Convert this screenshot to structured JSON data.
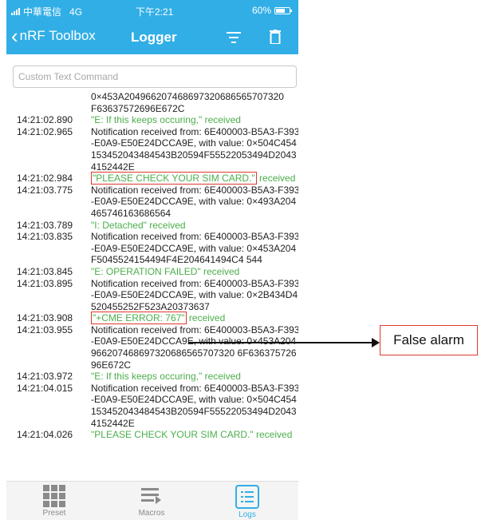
{
  "status_bar": {
    "carrier": "中華電信",
    "network": "4G",
    "time": "下午2:21",
    "battery": "60%"
  },
  "nav": {
    "back_label": "nRF Toolbox",
    "title": "Logger"
  },
  "command": {
    "placeholder": "Custom Text Command",
    "value": ""
  },
  "log_entries": [
    {
      "time": "",
      "text": "0×453A204966207468697320686565707320",
      "green": false
    },
    {
      "time": "",
      "text": "F63637572696E672C",
      "green": false
    },
    {
      "time": "14:21:02.890",
      "text": "\"E: If this keeps occuring,\" received",
      "green": true
    },
    {
      "time": "14:21:02.965",
      "text": "Notification received from: 6E400003-B5A3-F393-E0A9-E50E24DCCA9E, with value: 0×504C454153452043484543B20594F55522053494D20434152442E",
      "green": false
    },
    {
      "time": "14:21:02.984",
      "highlight": "\"PLEASE CHECK YOUR SIM CARD.\"",
      "text": " received",
      "green": true
    },
    {
      "time": "14:21:03.775",
      "text": "Notification received from: 6E400003-B5A3-F393-E0A9-E50E24DCCA9E, with value: 0×493A204465746163686564",
      "green": false
    },
    {
      "time": "14:21:03.789",
      "text": "\"I: Detached\" received",
      "green": true
    },
    {
      "time": "14:21:03.835",
      "text": "Notification received from: 6E400003-B5A3-F393-E0A9-E50E24DCCA9E, with value: 0×453A204F5045524154494F4E204641494C4 544",
      "green": false
    },
    {
      "time": "14:21:03.845",
      "text": "\"E: OPERATION FAILED\" received",
      "green": true
    },
    {
      "time": "14:21:03.895",
      "text": "Notification received from: 6E400003-B5A3-F393-E0A9-E50E24DCCA9E, with value: 0×2B434D4520455252F523A20373637",
      "green": false
    },
    {
      "time": "14:21:03.908",
      "highlight": "\"+CME ERROR: 767\"",
      "text": " received",
      "green": true
    },
    {
      "time": "14:21:03.955",
      "text": "Notification received from: 6E400003-B5A3-F393-E0A9-E50E24DCCA9E, with value: 0×453A204966207468697320686565707320 6F63637572696E672C",
      "green": false
    },
    {
      "time": "14:21:03.972",
      "text": "\"E: If this keeps occuring,\" received",
      "green": true
    },
    {
      "time": "14:21:04.015",
      "text": "Notification received from: 6E400003-B5A3-F393-E0A9-E50E24DCCA9E, with value: 0×504C454153452043484543B20594F55522053494D20434152442E",
      "green": false
    },
    {
      "time": "14:21:04.026",
      "text": "\"PLEASE CHECK YOUR SIM CARD.\" received",
      "green": true
    }
  ],
  "tabs": [
    {
      "label": "Preset",
      "icon": "grid-icon"
    },
    {
      "label": "Macros",
      "icon": "macros-icon"
    },
    {
      "label": "Logs",
      "icon": "logs-icon",
      "active": true
    }
  ],
  "annotation": {
    "label": "False alarm"
  },
  "colors": {
    "accent": "#31aee6",
    "log_green": "#4cae4c",
    "highlight_red": "#e0382f"
  }
}
